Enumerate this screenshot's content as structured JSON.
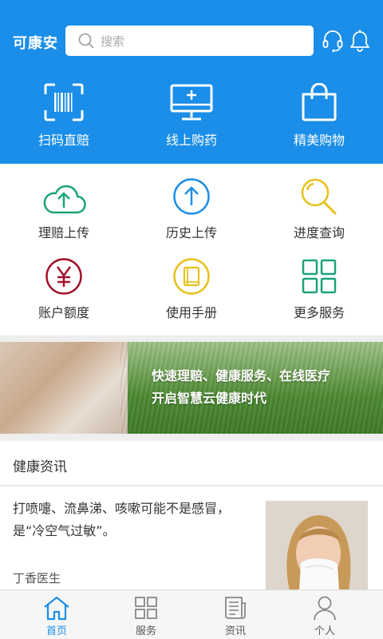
{
  "header": {
    "title": "可康安",
    "search_placeholder": "搜索",
    "icons": [
      "headset-icon",
      "bell-icon"
    ],
    "accent_color": "#1a8ee8"
  },
  "quick_actions": [
    {
      "label": "扫码直赔",
      "icon": "barcode-scan-icon"
    },
    {
      "label": "线上购药",
      "icon": "monitor-plus-icon"
    },
    {
      "label": "精美购物",
      "icon": "shopping-bag-icon"
    }
  ],
  "services": [
    {
      "label": "理赔上传",
      "icon": "cloud-upload-icon",
      "color": "#1aa37a"
    },
    {
      "label": "历史上传",
      "icon": "arrow-up-circle-icon",
      "color": "#1a8ee8"
    },
    {
      "label": "进度查询",
      "icon": "magnifier-icon",
      "color": "#e8c21a"
    },
    {
      "label": "账户额度",
      "icon": "yuan-circle-icon",
      "color": "#a3122a"
    },
    {
      "label": "使用手册",
      "icon": "book-icon",
      "color": "#e8c21a"
    },
    {
      "label": "更多服务",
      "icon": "grid-icon",
      "color": "#1aa37a"
    }
  ],
  "banner": {
    "line1": "快速理赔、健康服务、在线医疗",
    "line2": "开启智慧云健康时代"
  },
  "news": {
    "section_title": "健康资讯",
    "items": [
      {
        "title": "打喷嚏、流鼻涕、咳嗽可能不是感冒，是“冷空气过敏”。",
        "source": "丁香医生"
      }
    ]
  },
  "bottom_nav": [
    {
      "label": "首页",
      "icon": "home-icon",
      "active": true
    },
    {
      "label": "服务",
      "icon": "grid-icon",
      "active": false
    },
    {
      "label": "资讯",
      "icon": "news-icon",
      "active": false
    },
    {
      "label": "个人",
      "icon": "person-icon",
      "active": false
    }
  ]
}
